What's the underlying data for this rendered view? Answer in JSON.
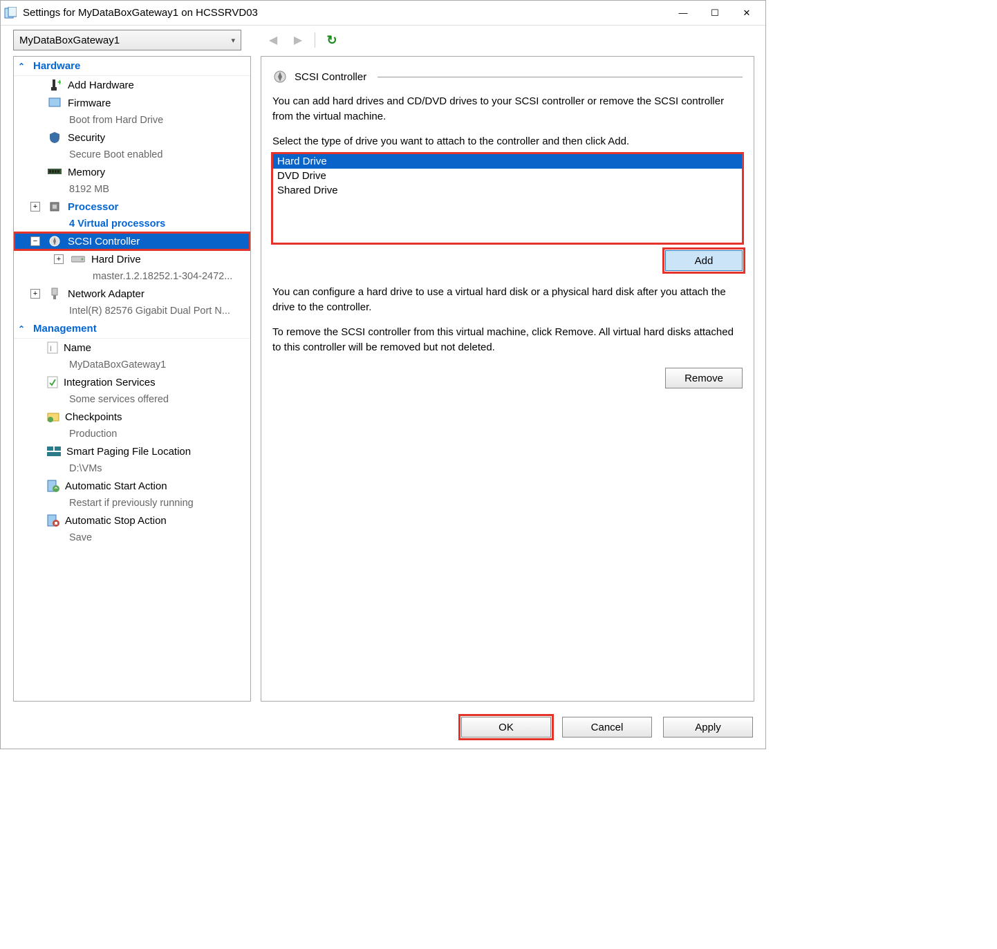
{
  "window": {
    "title": "Settings for MyDataBoxGateway1 on HCSSRVD03"
  },
  "toolbar": {
    "vm_selected": "MyDataBoxGateway1"
  },
  "sidebar": {
    "hardware_header": "Hardware",
    "management_header": "Management",
    "items": {
      "add_hardware": {
        "label": "Add Hardware"
      },
      "firmware": {
        "label": "Firmware",
        "sub": "Boot from Hard Drive"
      },
      "security": {
        "label": "Security",
        "sub": "Secure Boot enabled"
      },
      "memory": {
        "label": "Memory",
        "sub": "8192 MB"
      },
      "processor": {
        "label": "Processor",
        "sub": "4 Virtual processors"
      },
      "scsi": {
        "label": "SCSI Controller"
      },
      "hard_drive": {
        "label": "Hard Drive",
        "sub": "master.1.2.18252.1-304-2472..."
      },
      "network": {
        "label": "Network Adapter",
        "sub": "Intel(R) 82576 Gigabit Dual Port N..."
      },
      "name": {
        "label": "Name",
        "sub": "MyDataBoxGateway1"
      },
      "integration": {
        "label": "Integration Services",
        "sub": "Some services offered"
      },
      "checkpoints": {
        "label": "Checkpoints",
        "sub": "Production"
      },
      "paging": {
        "label": "Smart Paging File Location",
        "sub": "D:\\VMs"
      },
      "autostart": {
        "label": "Automatic Start Action",
        "sub": "Restart if previously running"
      },
      "autostop": {
        "label": "Automatic Stop Action",
        "sub": "Save"
      }
    }
  },
  "content": {
    "title": "SCSI Controller",
    "desc1": "You can add hard drives and CD/DVD drives to your SCSI controller or remove the SCSI controller from the virtual machine.",
    "desc2": "Select the type of drive you want to attach to the controller and then click Add.",
    "options": [
      "Hard Drive",
      "DVD Drive",
      "Shared Drive"
    ],
    "add_label": "Add",
    "desc3": "You can configure a hard drive to use a virtual hard disk or a physical hard disk after you attach the drive to the controller.",
    "desc4": "To remove the SCSI controller from this virtual machine, click Remove. All virtual hard disks attached to this controller will be removed but not deleted.",
    "remove_label": "Remove"
  },
  "footer": {
    "ok": "OK",
    "cancel": "Cancel",
    "apply": "Apply"
  }
}
